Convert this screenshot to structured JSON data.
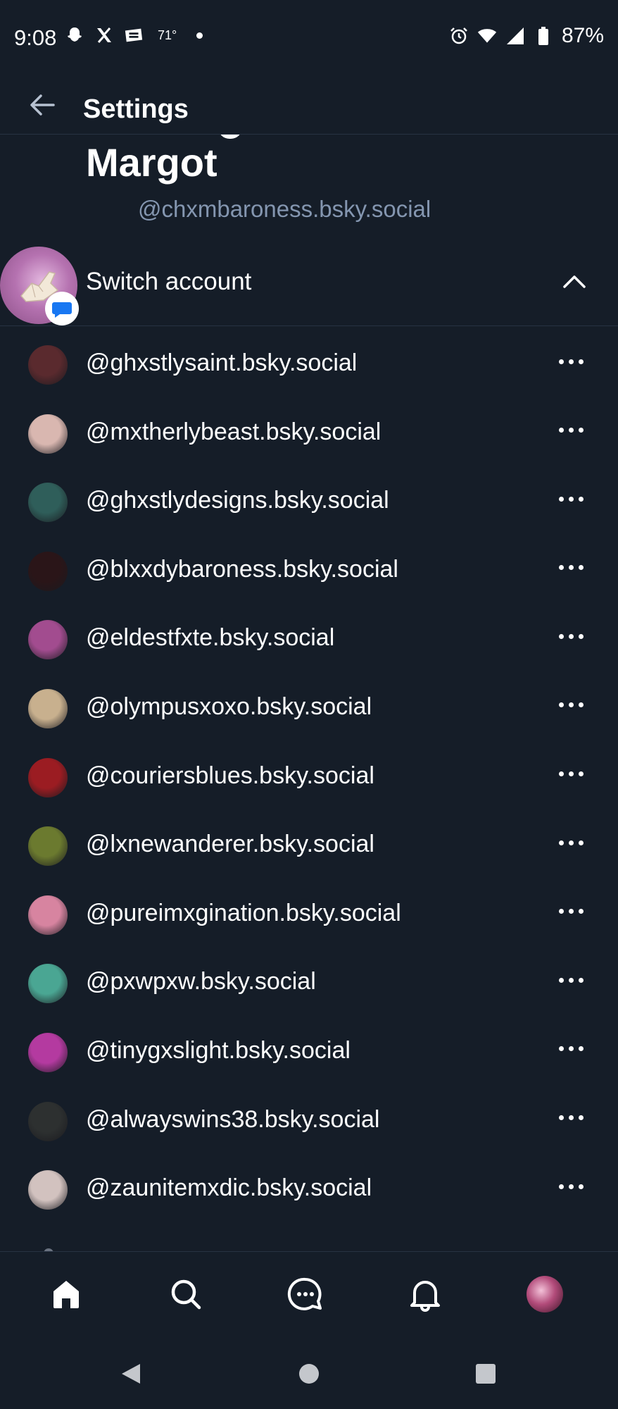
{
  "status_bar": {
    "time": "9:08",
    "temperature": "71°",
    "battery": "87%",
    "icons_left": [
      "snapchat-icon",
      "x-icon",
      "webtoon-icon"
    ],
    "icons_right": [
      "alarm-icon",
      "wifi-icon",
      "signal-icon",
      "battery-icon"
    ]
  },
  "header": {
    "title": "Settings"
  },
  "profile": {
    "display_name": "Margot",
    "handle": "@chxmbaroness.bsky.social"
  },
  "switch_account": {
    "label": "Switch account"
  },
  "accounts": [
    {
      "handle": "@ghxstlysaint.bsky.social",
      "color": "#5a2a2e"
    },
    {
      "handle": "@mxtherlybeast.bsky.social",
      "color": "#d9b7b0"
    },
    {
      "handle": "@ghxstlydesigns.bsky.social",
      "color": "#2f5e5a"
    },
    {
      "handle": "@blxxdybaroness.bsky.social",
      "color": "#2a1518"
    },
    {
      "handle": "@eldestfxte.bsky.social",
      "color": "#a24c8f"
    },
    {
      "handle": "@olympusxoxo.bsky.social",
      "color": "#c8b08e"
    },
    {
      "handle": "@couriersblues.bsky.social",
      "color": "#9b1c22"
    },
    {
      "handle": "@lxnewanderer.bsky.social",
      "color": "#6b7a2f"
    },
    {
      "handle": "@pureimxgination.bsky.social",
      "color": "#d784a0"
    },
    {
      "handle": "@pxwpxw.bsky.social",
      "color": "#4aa693"
    },
    {
      "handle": "@tinygxslight.bsky.social",
      "color": "#b43aa0"
    },
    {
      "handle": "@alwayswins38.bsky.social",
      "color": "#2d3030"
    },
    {
      "handle": "@zaunitemxdic.bsky.social",
      "color": "#d2c2bf"
    }
  ],
  "colors": {
    "background": "#151d28",
    "divider": "#273242",
    "secondary_text": "#8496b0",
    "message_badge": "#1877f2"
  }
}
